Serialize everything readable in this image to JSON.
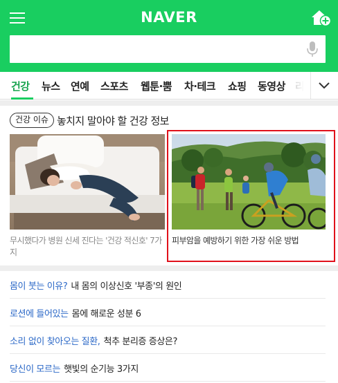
{
  "header": {
    "logo": "NAVER",
    "menu_icon": "hamburger-menu-icon",
    "home_icon": "home-add-icon",
    "brand_color": "#19ce60"
  },
  "search": {
    "value": "",
    "placeholder": "",
    "mic_icon": "microphone-icon"
  },
  "tabs": {
    "items": [
      {
        "label": "건강",
        "active": true
      },
      {
        "label": "뉴스"
      },
      {
        "label": "연예"
      },
      {
        "label": "스포츠"
      },
      {
        "label": "웹툰·뿜"
      },
      {
        "label": "차·테크"
      },
      {
        "label": "쇼핑"
      },
      {
        "label": "동영상"
      },
      {
        "label": "리"
      }
    ],
    "more_icon": "chevron-down-icon"
  },
  "section": {
    "badge": "건강 이슈",
    "title": "놓치지 말아야 할 건강 정보"
  },
  "cards": [
    {
      "caption": "무시했다가 병원 신세 진다는 '건강 적신호' 7가지"
    },
    {
      "caption": "피부암을 예방하기 위한 가장 쉬운 방법",
      "highlight_color": "#e0101a"
    }
  ],
  "list": [
    {
      "keyword": "몸이 붓는 이유?",
      "text": "내 몸의 이상신호 '부종'의 원인"
    },
    {
      "keyword": "로션에 들어있는",
      "text": "몸에 해로운 성분 6"
    },
    {
      "keyword": "소리 없이 찾아오는 질환,",
      "text": "척추 분리증 증상은?"
    },
    {
      "keyword": "당신이 모르는",
      "text": "햇빛의 순기능 3가지"
    }
  ]
}
